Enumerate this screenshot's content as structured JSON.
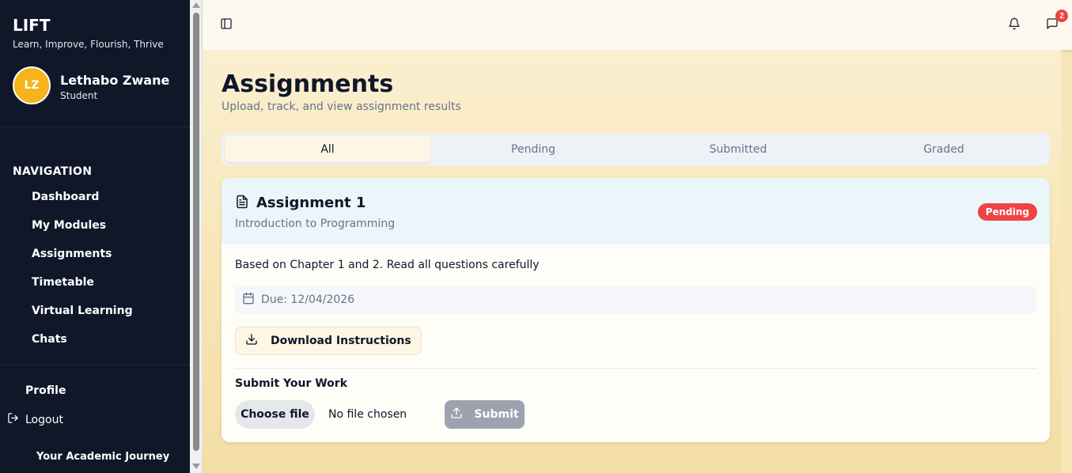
{
  "brand": {
    "title": "LIFT",
    "tagline": "Learn, Improve, Flourish, Thrive"
  },
  "user": {
    "initials": "LZ",
    "name": "Lethabo Zwane",
    "role": "Student"
  },
  "navigation": {
    "heading": "NAVIGATION",
    "items": [
      {
        "label": "Dashboard"
      },
      {
        "label": "My Modules"
      },
      {
        "label": "Assignments"
      },
      {
        "label": "Timetable"
      },
      {
        "label": "Virtual Learning"
      },
      {
        "label": "Chats"
      }
    ]
  },
  "account": {
    "profile": "Profile",
    "logout": "Logout"
  },
  "footer": {
    "journey": "Your Academic Journey"
  },
  "header": {
    "sidebar_toggle_icon": "sidebar-toggle-icon",
    "bell_icon": "bell-icon",
    "chat_icon": "chat-icon",
    "chat_badge": "2"
  },
  "page": {
    "title": "Assignments",
    "subtitle": "Upload, track, and view assignment results"
  },
  "tabs": [
    {
      "label": "All",
      "active": true
    },
    {
      "label": "Pending",
      "active": false
    },
    {
      "label": "Submitted",
      "active": false
    },
    {
      "label": "Graded",
      "active": false
    }
  ],
  "assignment": {
    "title": "Assignment 1",
    "module": "Introduction to Programming",
    "status": "Pending",
    "status_color": "#ef4444",
    "description": "Based on Chapter 1 and 2. Read all questions carefully",
    "due": "Due: 12/04/2026",
    "download_label": "Download Instructions",
    "submit_heading": "Submit Your Work",
    "choose_file_label": "Choose file",
    "no_file_text": "No file chosen",
    "submit_label": "Submit"
  },
  "colors": {
    "sidebar_bg": "#0f1729",
    "accent": "#f5b41c",
    "pending_badge": "#ef4444"
  }
}
